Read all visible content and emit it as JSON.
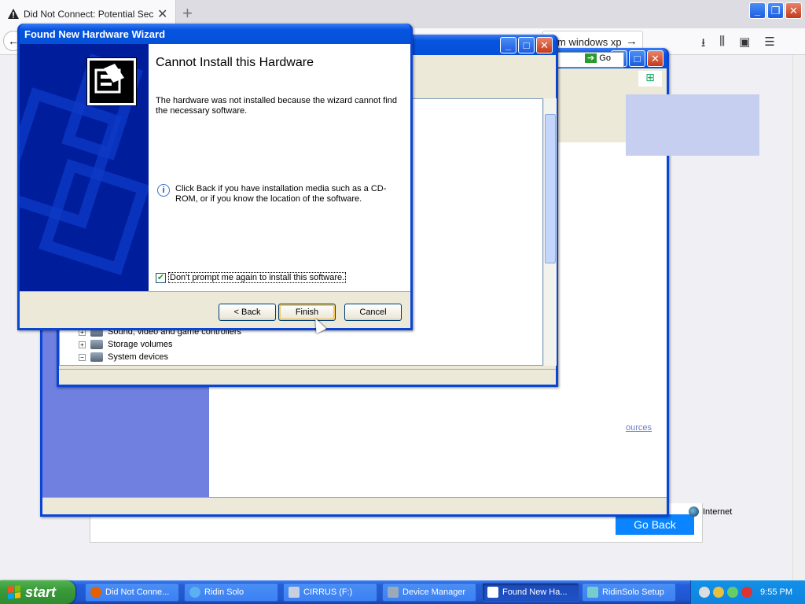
{
  "firefox": {
    "tab_title": "Did Not Connect: Potential Security Issue",
    "url_text": "m windows xp",
    "page_button": "Go Back"
  },
  "ie": {
    "go_label": "Go",
    "link_text": "ources",
    "zone_label": "Internet"
  },
  "device_manager": {
    "tree_items": [
      "Sound, video and game controllers",
      "Storage volumes",
      "System devices"
    ]
  },
  "wizard": {
    "title": "Found New Hardware Wizard",
    "heading": "Cannot Install this Hardware",
    "message": "The hardware was not installed because the wizard cannot find the necessary software.",
    "info": "Click Back if you have installation media such as a CD-ROM, or if you know the location of the software.",
    "checkbox_label": "Don't prompt me again to install this software.",
    "checkbox_checked": true,
    "back_label": "< Back",
    "finish_label": "Finish",
    "cancel_label": "Cancel"
  },
  "taskbar": {
    "start_label": "start",
    "tasks": [
      {
        "label": "Did Not Conne...",
        "active": false
      },
      {
        "label": "Ridin Solo",
        "active": false
      },
      {
        "label": "CIRRUS (F:)",
        "active": false
      },
      {
        "label": "Device Manager",
        "active": false
      },
      {
        "label": "Found New Ha...",
        "active": true
      },
      {
        "label": "RidinSolo Setup",
        "active": false
      }
    ],
    "clock": "9:55 PM"
  },
  "colors": {
    "xp_blue": "#0a46d6",
    "taskbar_blue": "#245edb",
    "start_green": "#3a9b3a",
    "wizard_side": "#001d9c"
  }
}
